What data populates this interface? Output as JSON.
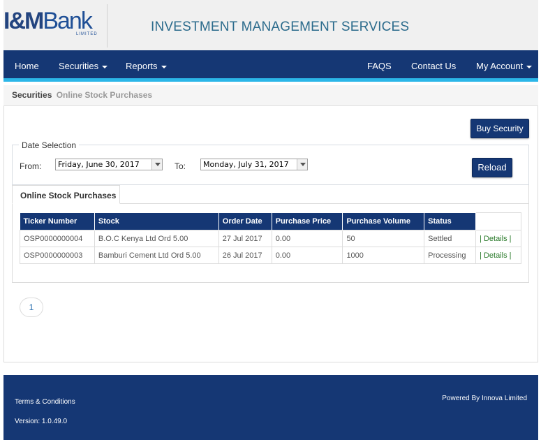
{
  "brand": {
    "logo_text_im": "I&M",
    "logo_text_bank": "Bank",
    "logo_sub": "LIMITED",
    "site_title": "INVESTMENT MANAGEMENT SERVICES"
  },
  "nav": {
    "home": "Home",
    "securities": "Securities",
    "reports": "Reports",
    "faqs": "FAQS",
    "contact": "Contact Us",
    "account": "My Account"
  },
  "breadcrumb": {
    "first": "Securities",
    "second": "Online Stock Purchases"
  },
  "actions": {
    "buy": "Buy Security",
    "reload": "Reload"
  },
  "date_selection": {
    "legend": "Date Selection",
    "from_label": "From:",
    "from_value": "Friday, June 30, 2017",
    "to_label": "To:",
    "to_value": "Monday, July 31, 2017"
  },
  "tab": {
    "label": "Online Stock Purchases"
  },
  "table": {
    "headers": [
      "Ticker Number",
      "Stock",
      "Order Date",
      "Purchase Price",
      "Purchase Volume",
      "Status"
    ],
    "rows": [
      {
        "ticker": "OSP0000000004",
        "stock": "B.O.C Kenya Ltd Ord 5.00",
        "date": "27 Jul 2017",
        "price": "0.00",
        "volume": "50",
        "status": "Settled",
        "action": "| Details |"
      },
      {
        "ticker": "OSP0000000003",
        "stock": "Bamburi Cement Ltd Ord 5.00",
        "date": "26 Jul 2017",
        "price": "0.00",
        "volume": "1000",
        "status": "Processing",
        "action": "| Details |"
      }
    ]
  },
  "pager": {
    "current": "1"
  },
  "footer": {
    "terms": "Terms & Conditions",
    "version": "Version: 1.0.49.0",
    "powered": "Powered By Innova Limited"
  },
  "colors": {
    "navy": "#153774",
    "accent": "#2bb6e8",
    "title": "#2b6b8c",
    "link": "#2a7a2a"
  }
}
